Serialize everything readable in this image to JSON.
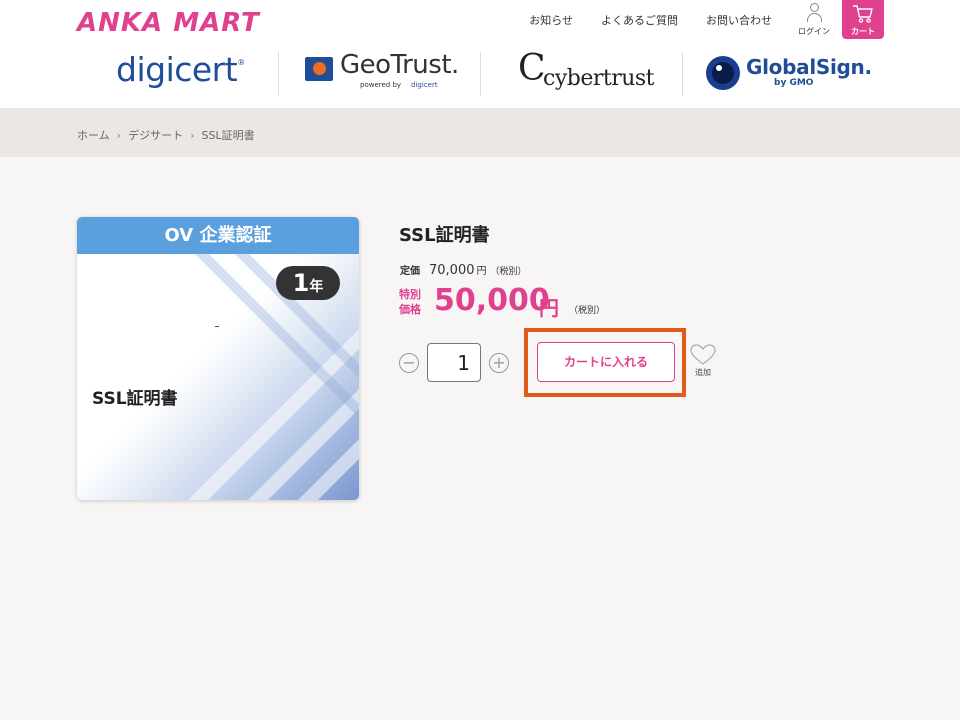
{
  "header": {
    "logo": "ANKA MART",
    "nav": [
      "お知らせ",
      "よくあるご質問",
      "お問い合わせ"
    ],
    "login_label": "ログイン",
    "cart_label": "カート"
  },
  "brands": {
    "digicert": "digicert",
    "geotrust": "GeoTrust.",
    "geotrust_powered": "powered by",
    "geotrust_powered_brand": "digicert",
    "cybertrust_mark": "C",
    "cybertrust": "cybertrust",
    "globalsign": "GlobalSign.",
    "globalsign_sub": "by GMO"
  },
  "breadcrumb": [
    "ホーム",
    "デジサート",
    "SSL証明書"
  ],
  "card": {
    "header": "OV 企業認証",
    "badge_num": "1",
    "badge_unit": "年",
    "name": "SSL証明書"
  },
  "product": {
    "title": "SSL証明書",
    "list_label": "定価",
    "list_price": "70,000",
    "list_yen": "円",
    "list_tax": "（税別）",
    "sale_label": "特別価格",
    "sale_price": "50,000",
    "sale_yen": "円",
    "sale_tax": "（税別）",
    "quantity": "1",
    "add_to_cart": "カートに入れる",
    "favorite_label": "追加"
  },
  "colors": {
    "brand_pink": "#e0418f",
    "highlight_orange": "#e05a1b",
    "card_header_blue": "#5aa0dc"
  }
}
